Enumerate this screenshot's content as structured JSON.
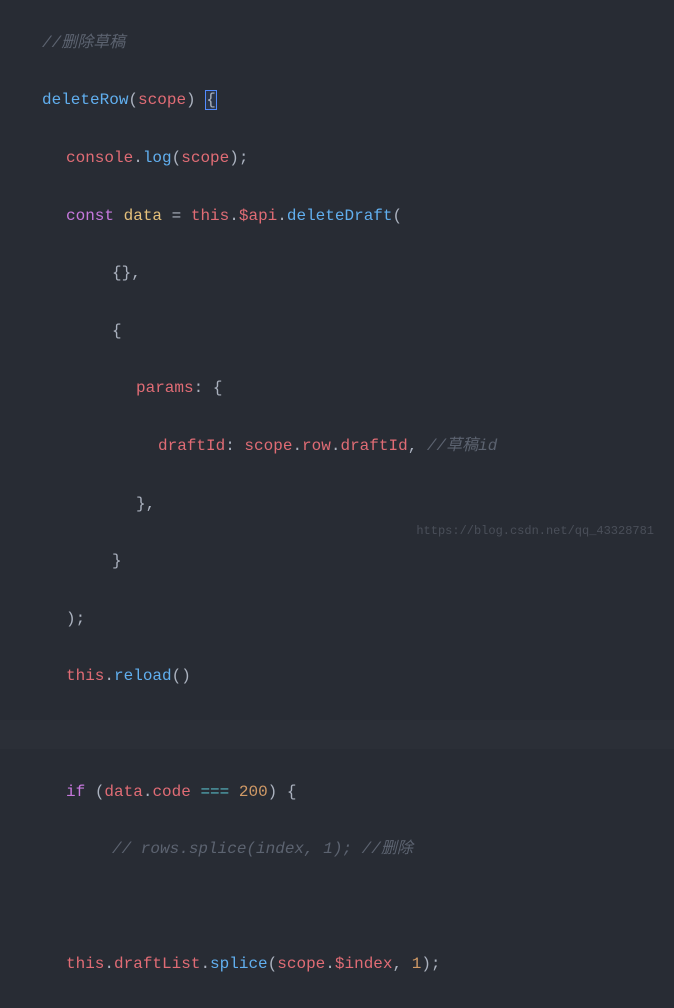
{
  "code": {
    "comment1": "//删除草稿",
    "funcName": "deleteRow",
    "funcParen": "(",
    "funcParam": "scope",
    "funcParenClose": ") ",
    "funcBraceOpen": "{",
    "console": "console",
    "log": "log",
    "logArg": "scope",
    "const": "const",
    "dataVar": "data",
    "eq": " = ",
    "this1": "this",
    "api": "$api",
    "deleteDraft": "deleteDraft",
    "emptyObj": "{}",
    "comma": ",",
    "params": "params",
    "colon": ": ",
    "draftId": "draftId",
    "scope": "scope",
    "row": "row",
    "draftIdProp": "draftId",
    "comment2": "//草稿id",
    "closeParen": ");",
    "reload": "reload",
    "emptyParens": "()",
    "if": "if",
    "dataCode": "data",
    "code": "code",
    "tripleEq": " === ",
    "status": "200",
    "comment3": "// rows.splice(index, 1); //删除",
    "draftList": "draftList",
    "splice": "splice",
    "index": "$index",
    "one": "1"
  },
  "watermark": "https://blog.csdn.net/qq_43328781"
}
